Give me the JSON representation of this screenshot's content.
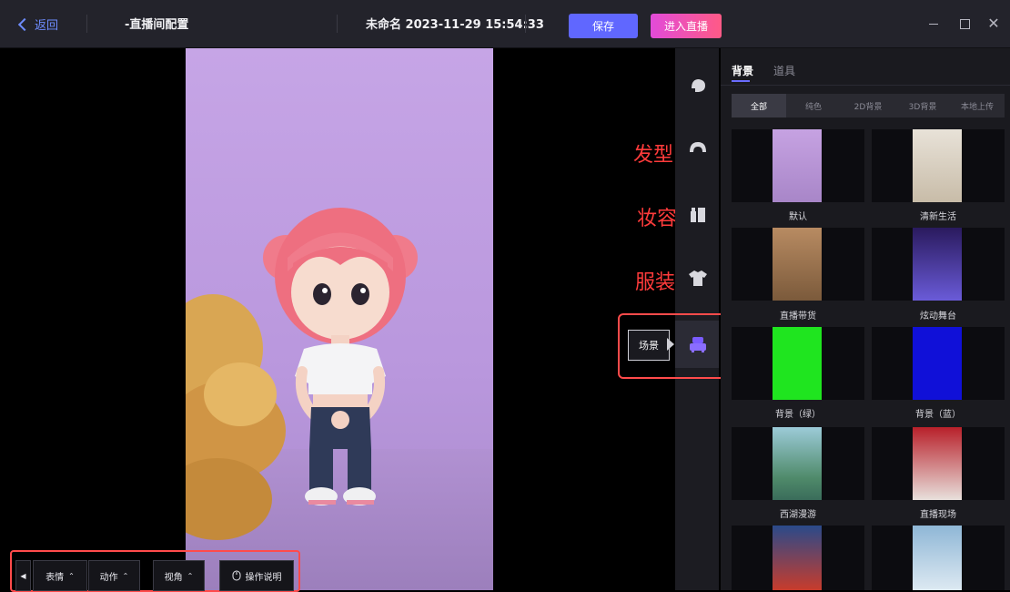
{
  "topbar": {
    "back_label": "返回",
    "page_title": "-直播间配置",
    "project_name": "未命名 2023-11-29 15:54:33",
    "save_label": "保存",
    "go_live_label": "进入直播",
    "minimize_glyph": "−",
    "maximize_glyph": "□",
    "close_glyph": "✕"
  },
  "annotations": {
    "hair": "发型",
    "makeup": "妆容",
    "clothing": "服装"
  },
  "tool_rail": {
    "icons": [
      "face-icon",
      "hair-icon",
      "makeup-icon",
      "clothing-icon",
      "scene-icon"
    ],
    "tooltip": "场景"
  },
  "panel": {
    "tabs": [
      {
        "label": "背景",
        "active": true
      },
      {
        "label": "道具",
        "active": false
      }
    ],
    "filters": [
      {
        "label": "全部",
        "active": true
      },
      {
        "label": "纯色",
        "active": false
      },
      {
        "label": "2D背景",
        "active": false
      },
      {
        "label": "3D背景",
        "active": false
      },
      {
        "label": "本地上传",
        "active": false
      }
    ],
    "items": [
      {
        "label": "默认"
      },
      {
        "label": "清新生活"
      },
      {
        "label": "直播带货"
      },
      {
        "label": "炫动舞台"
      },
      {
        "label": "背景（绿）"
      },
      {
        "label": "背景（蓝）"
      },
      {
        "label": "西湖漫游"
      },
      {
        "label": "直播现场"
      },
      {
        "label": ""
      },
      {
        "label": ""
      }
    ]
  },
  "bottom_controls": {
    "expression": "表情",
    "motion": "动作",
    "view_angle": "视角",
    "instructions": "操作说明"
  },
  "colors": {
    "accent": "#6067ff",
    "live_gradient_start": "#e24bd9",
    "live_gradient_end": "#ff5a86",
    "annotation_red": "#ff3b3b"
  }
}
